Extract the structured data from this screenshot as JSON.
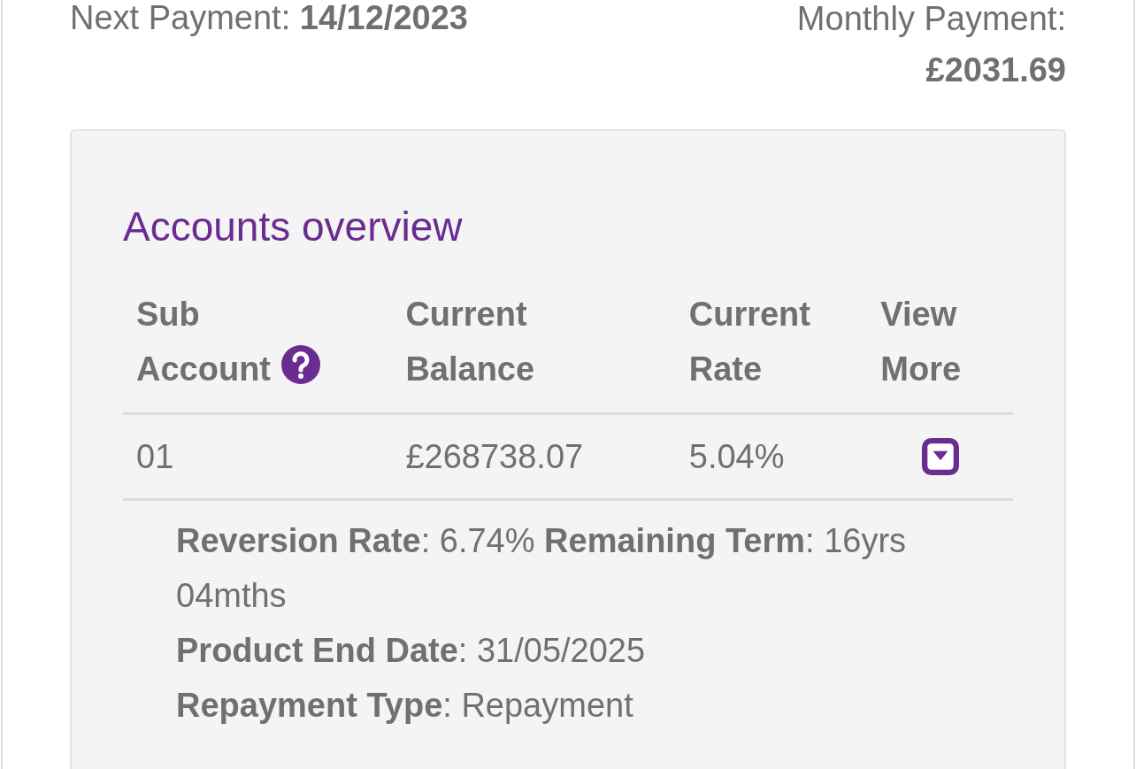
{
  "summary": {
    "next_payment_label": "Next Payment:",
    "next_payment": "14/12/2023",
    "monthly_payment_label": "Monthly Payment:",
    "monthly_payment": "£2031.69"
  },
  "accounts": {
    "title": "Accounts overview",
    "columns": [
      {
        "label": "Sub Account",
        "kind": "help"
      },
      {
        "label": "Current Balance",
        "kind": "plain"
      },
      {
        "label": "Current Rate",
        "kind": "plain"
      },
      {
        "label": "View More",
        "kind": "plain"
      }
    ],
    "rows": [
      {
        "cells": [
          "01",
          "£268738.07",
          "5.04%"
        ],
        "expanded": true,
        "details": [
          "**Reversion Rate**: 6.74% **Remaining Term**: 16yrs 04mths",
          "**Product End Date**: 31/05/2025",
          "**Repayment Type**: Repayment"
        ]
      }
    ]
  }
}
